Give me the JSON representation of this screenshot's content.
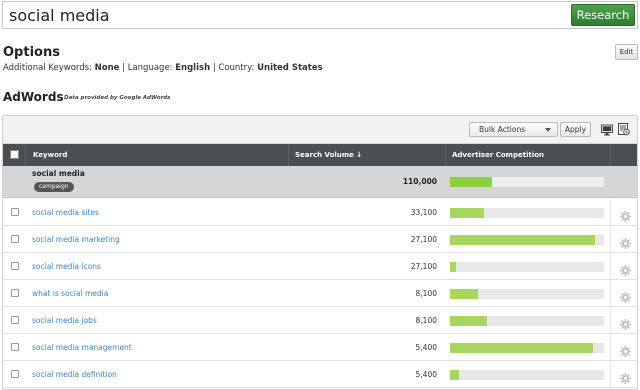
{
  "search": {
    "query": "social media",
    "button_label": "Research"
  },
  "options": {
    "title": "Options",
    "edit_label": "Edit",
    "additional_label": "Additional Keywords: ",
    "additional_value": "None",
    "language_label": " | Language: ",
    "language_value": "English",
    "country_label": " | Country: ",
    "country_value": "United States"
  },
  "adwords": {
    "title": "AdWords",
    "subtitle": "Data provided by Google AdWords"
  },
  "toolbar": {
    "bulk_actions_label": "Bulk Actions",
    "apply_label": "Apply",
    "icons": [
      "monitor-icon",
      "export-icon"
    ]
  },
  "table": {
    "headers": {
      "keyword": "Keyword",
      "volume": "Search Volume ↓",
      "competition": "Advertiser Competition"
    },
    "summary": {
      "keyword": "social media",
      "tag": "campaign",
      "volume": "110,000",
      "competition": 0.27
    },
    "rows": [
      {
        "keyword": "social media sites",
        "volume": "33,100",
        "competition": 0.22
      },
      {
        "keyword": "social media marketing",
        "volume": "27,100",
        "competition": 0.94
      },
      {
        "keyword": "social media icons",
        "volume": "27,100",
        "competition": 0.04
      },
      {
        "keyword": "what is social media",
        "volume": "8,100",
        "competition": 0.18
      },
      {
        "keyword": "social media jobs",
        "volume": "8,100",
        "competition": 0.24
      },
      {
        "keyword": "social media management",
        "volume": "5,400",
        "competition": 0.93
      },
      {
        "keyword": "social media definition",
        "volume": "5,400",
        "competition": 0.06
      }
    ]
  },
  "colors": {
    "research_green": "#2e7d32",
    "bar_green": "#a9d65e",
    "header_dark": "#4a4f53",
    "link_blue": "#3d84c6"
  }
}
